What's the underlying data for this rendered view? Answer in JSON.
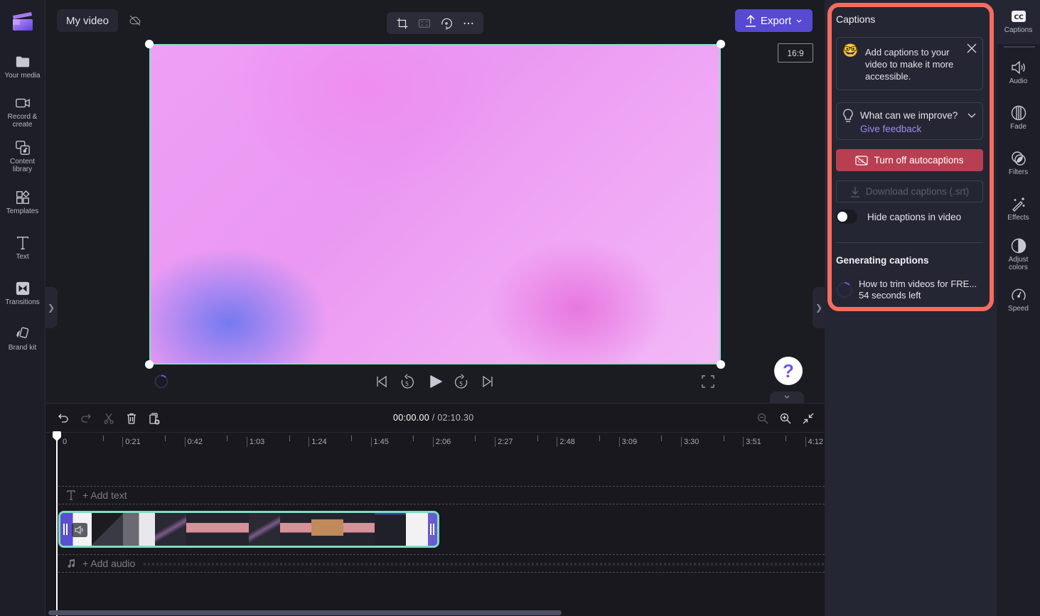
{
  "app": {
    "project_title": "My video",
    "aspect_ratio": "16:9",
    "export_label": "Export"
  },
  "left_sidebar": {
    "items": [
      {
        "label": "Your media",
        "icon": "folder-icon"
      },
      {
        "label": "Record &\ncreate",
        "icon": "video-camera-icon"
      },
      {
        "label": "Content\nlibrary",
        "icon": "content-library-icon"
      },
      {
        "label": "Templates",
        "icon": "templates-icon"
      },
      {
        "label": "Text",
        "icon": "text-icon"
      },
      {
        "label": "Transitions",
        "icon": "transitions-icon"
      },
      {
        "label": "Brand kit",
        "icon": "brand-kit-icon"
      }
    ]
  },
  "preview_toolbar": {
    "tools": [
      "crop-icon",
      "fit-icon",
      "rotate-icon",
      "more-icon"
    ]
  },
  "playback": {
    "controls": [
      "skip-to-start-icon",
      "rewind-5-icon",
      "play-icon",
      "forward-5-icon",
      "skip-to-end-icon"
    ],
    "help_symbol": "?"
  },
  "timeline": {
    "current_time": "00:00.00",
    "separator": " / ",
    "total_time": "02:10.30",
    "ruler_labels": [
      "0",
      "0:21",
      "0:42",
      "1:03",
      "1:24",
      "1:45",
      "2:06",
      "2:27",
      "2:48",
      "3:09",
      "3:30",
      "3:51",
      "4:12"
    ],
    "add_text_label": "+ Add text",
    "add_audio_label": "+ Add audio"
  },
  "captions_panel": {
    "title": "Captions",
    "tip_text": "Add captions to your video to make it more accessible.",
    "feedback_question": "What can we improve?",
    "feedback_link": "Give feedback",
    "turn_off_label": "Turn off autocaptions",
    "download_label": "Download captions (.srt)",
    "hide_toggle_label": "Hide captions in video",
    "hide_toggle_on": false,
    "generating_title": "Generating captions",
    "generating_item": "How to trim videos for FRE...",
    "generating_eta": "54 seconds left",
    "highlight_color": "#f76c5e",
    "turn_off_color": "#b73f51"
  },
  "right_sidebar": {
    "items": [
      {
        "label": "Captions",
        "icon": "captions-icon",
        "active": true
      },
      {
        "label": "Audio",
        "icon": "speaker-icon"
      },
      {
        "label": "Fade",
        "icon": "fade-icon"
      },
      {
        "label": "Filters",
        "icon": "filters-icon"
      },
      {
        "label": "Effects",
        "icon": "magic-wand-icon"
      },
      {
        "label": "Adjust\ncolors",
        "icon": "adjust-colors-icon"
      },
      {
        "label": "Speed",
        "icon": "speedometer-icon"
      }
    ]
  },
  "colors": {
    "accent": "#5749d1",
    "clip_border": "#7fdcc0",
    "link": "#9a8df0"
  }
}
